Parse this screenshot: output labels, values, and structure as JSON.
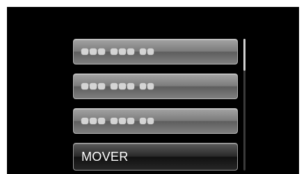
{
  "menu": {
    "items": [
      {
        "label": "",
        "state": "masked"
      },
      {
        "label": "",
        "state": "masked"
      },
      {
        "label": "",
        "state": "masked"
      },
      {
        "label": "MOVER",
        "state": "selected"
      }
    ]
  },
  "scrollbar": {
    "position_fraction": 0.0
  },
  "colors": {
    "background": "#000000",
    "item_gray": "#8a8a8a",
    "selected_item": "#1c1c1c",
    "text": "#ffffff"
  }
}
